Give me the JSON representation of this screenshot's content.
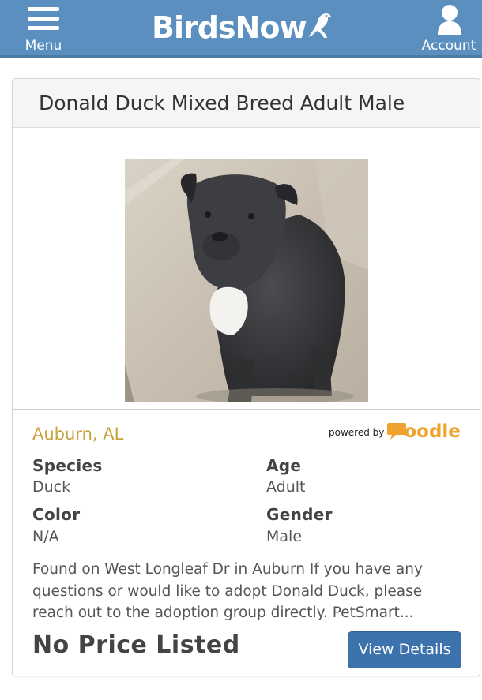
{
  "header": {
    "menu_label": "Menu",
    "logo_text": "BirdsNow",
    "account_label": "Account",
    "bg_color": "#5a8fbf"
  },
  "listing": {
    "title": "Donald Duck Mixed Breed Adult Male",
    "location": "Auburn, AL",
    "powered_by_text": "powered by",
    "powered_by_brand": "oodle",
    "fields": {
      "species_label": "Species",
      "species_value": "Duck",
      "age_label": "Age",
      "age_value": "Adult",
      "color_label": "Color",
      "color_value": "N/A",
      "gender_label": "Gender",
      "gender_value": "Male"
    },
    "description": "Found on West Longleaf Dr in Auburn If you have any questions or would like to adopt Donald Duck, please reach out to the adoption group directly. PetSmart...",
    "price": "No Price Listed",
    "view_details_label": "View Details"
  },
  "icons": {
    "menu": "hamburger-icon",
    "account": "user-icon",
    "logo_bird": "bird-icon"
  },
  "colors": {
    "location": "#c9a13b",
    "button": "#3d73ad",
    "oodle": "#f0a22e"
  }
}
